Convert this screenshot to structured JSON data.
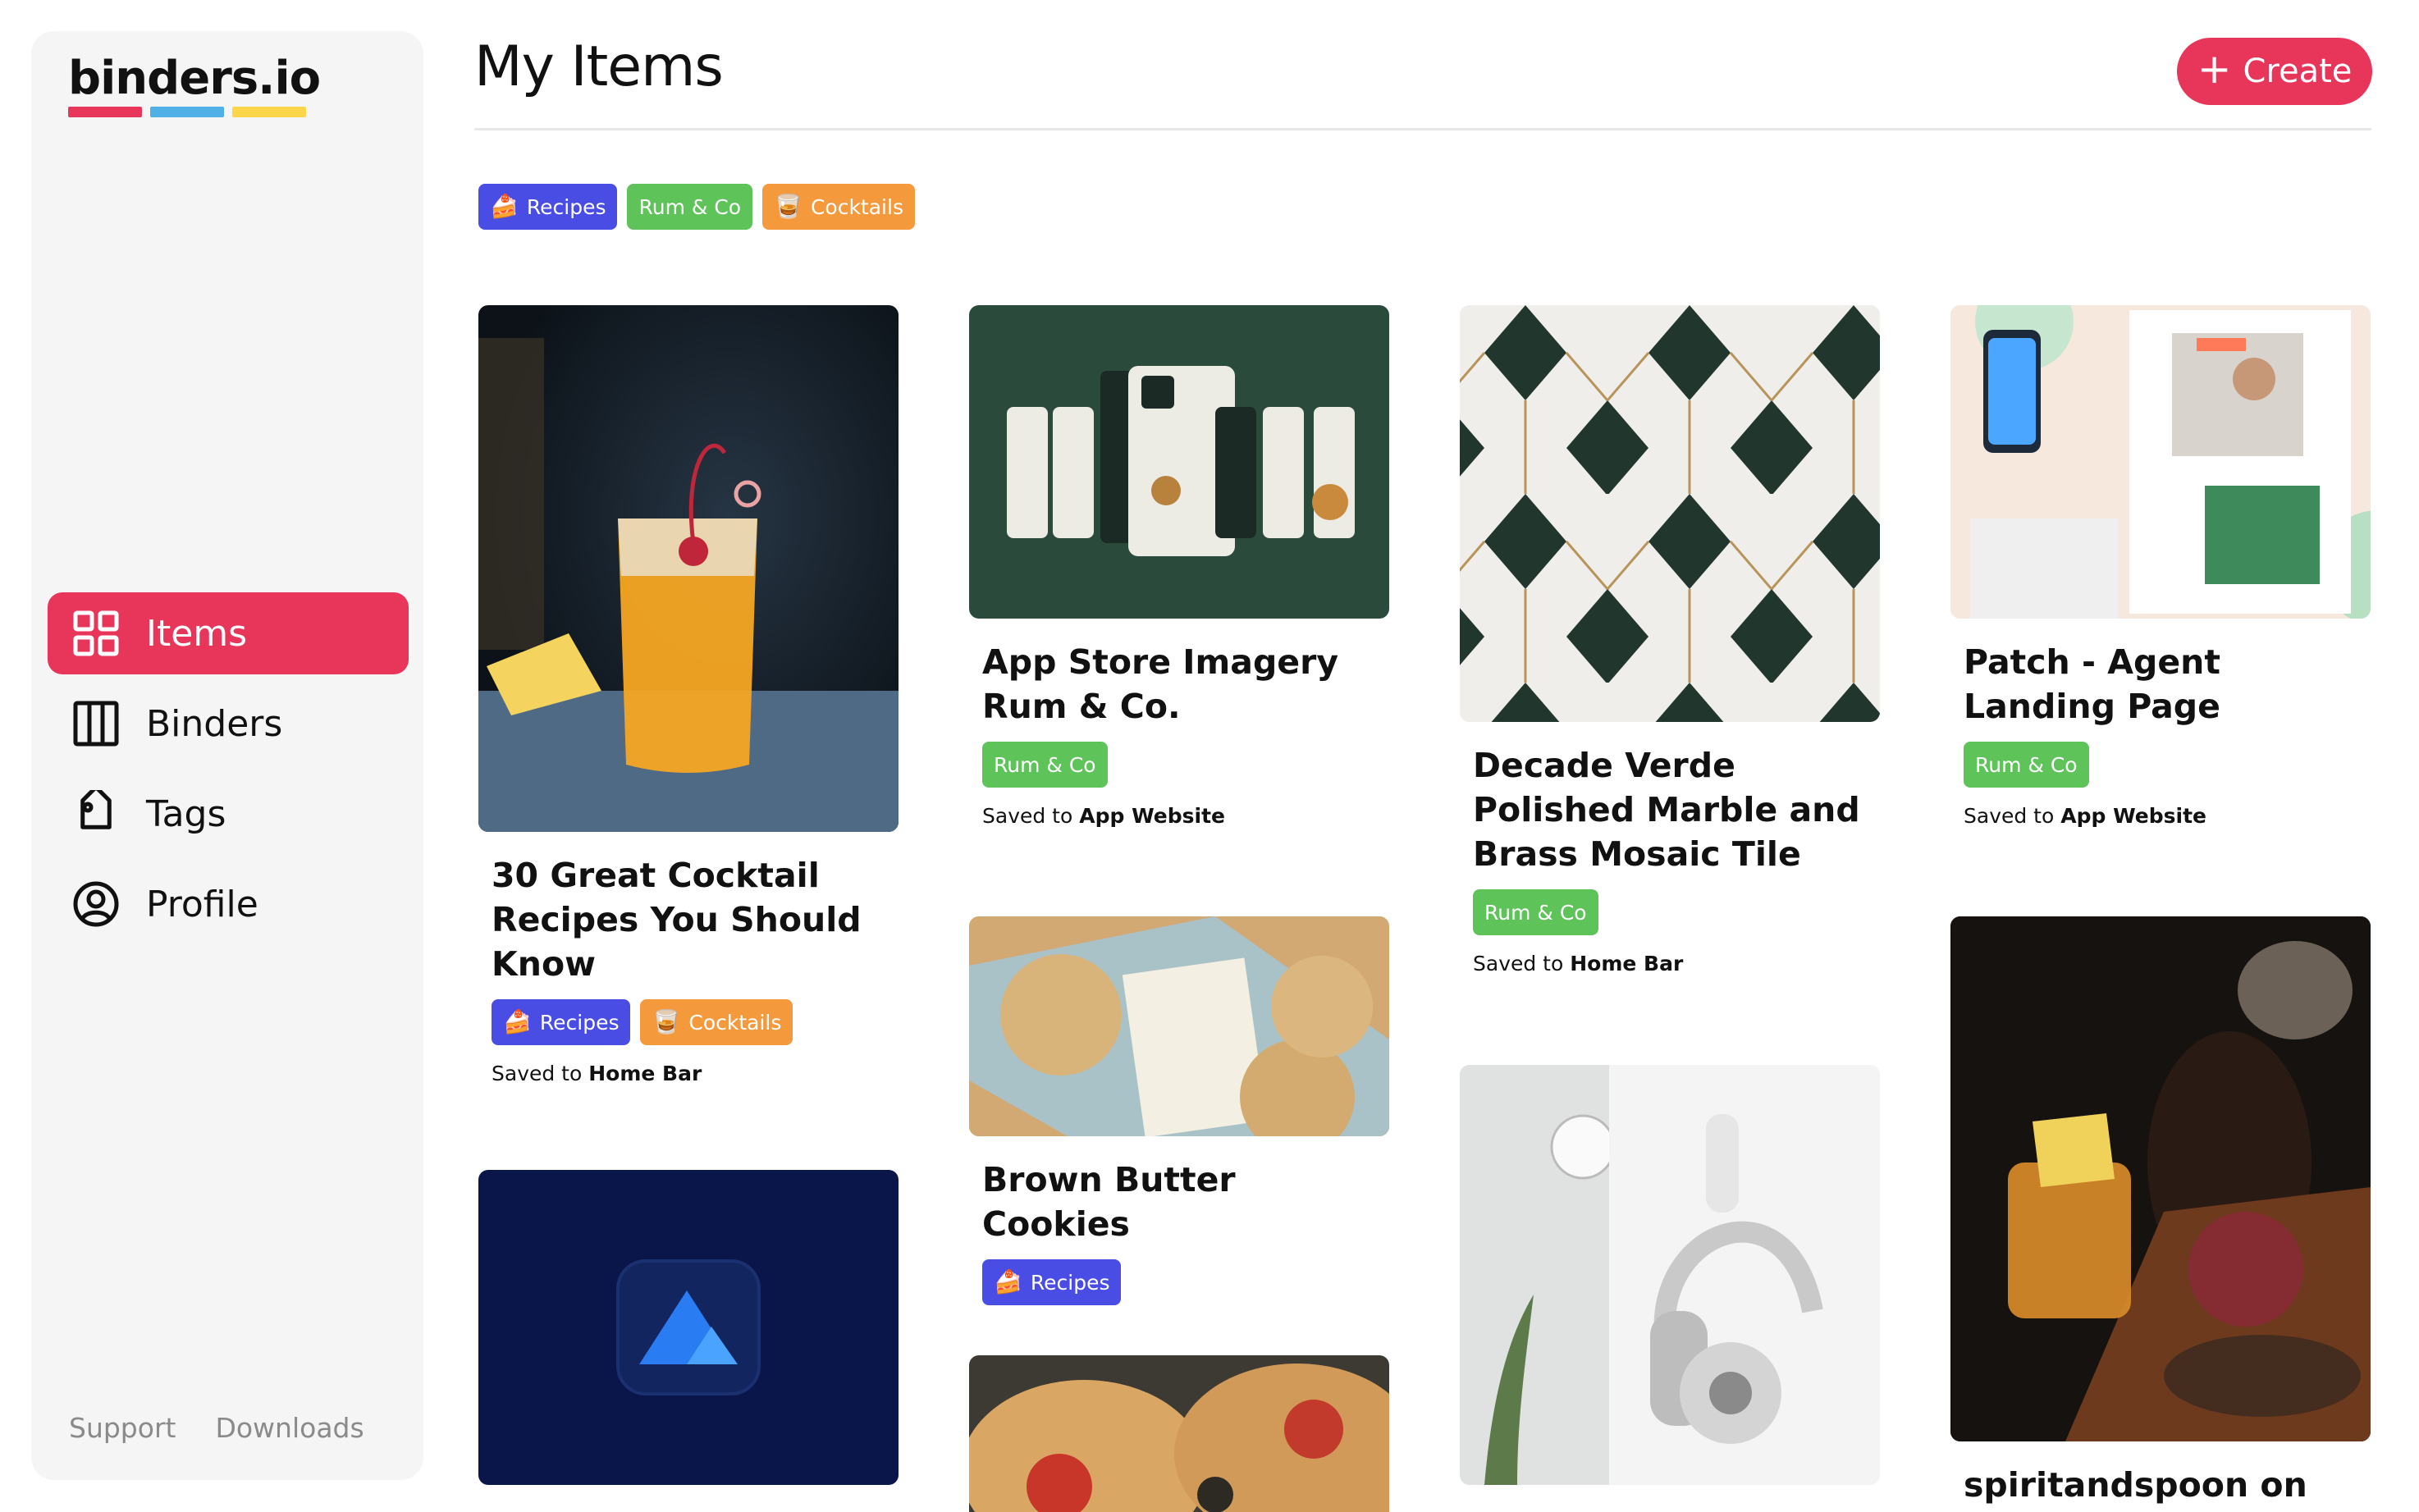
{
  "app": {
    "logo_text": "binders.io",
    "logo_colors": [
      "#e8365a",
      "#4fb0e6",
      "#fcd54b"
    ]
  },
  "sidebar": {
    "items": [
      {
        "label": "Items",
        "icon": "grid-icon",
        "active": true
      },
      {
        "label": "Binders",
        "icon": "columns-icon",
        "active": false
      },
      {
        "label": "Tags",
        "icon": "tag-icon",
        "active": false
      },
      {
        "label": "Profile",
        "icon": "user-circle-icon",
        "active": false
      }
    ],
    "footer": {
      "support": "Support",
      "downloads": "Downloads"
    }
  },
  "header": {
    "title": "My Items",
    "create_label": "Create"
  },
  "filters": [
    {
      "label": "Recipes",
      "color": "#4a4de3",
      "emoji": "🍰"
    },
    {
      "label": "Rum & Co",
      "color": "#5ec45a",
      "emoji": ""
    },
    {
      "label": "Cocktails",
      "color": "#f59a3c",
      "emoji": "🥃"
    }
  ],
  "tags": {
    "recipes": "Recipes",
    "rum": "Rum & Co",
    "cocktails": "Cocktails"
  },
  "saved_prefix": "Saved to",
  "cards": [
    {
      "title": "30 Great Cocktail Recipes You Should Know",
      "tags": [
        "Recipes",
        "Cocktails"
      ],
      "saved_to": "Home Bar"
    },
    {
      "title": "App Store Imagery Rum & Co.",
      "tags": [
        "Rum & Co"
      ],
      "saved_to": "App Website"
    },
    {
      "title": "Decade Verde Polished Marble and Brass Mosaic Tile",
      "tags": [
        "Rum & Co"
      ],
      "saved_to": "Home Bar"
    },
    {
      "title": "Patch - Agent Landing Page",
      "tags": [
        "Rum & Co"
      ],
      "saved_to": "App Website"
    },
    {
      "title": "Brown Butter Cookies",
      "tags": [
        "Recipes"
      ],
      "saved_to": ""
    },
    {
      "title": "spiritandspoon on",
      "tags": [],
      "saved_to": ""
    }
  ]
}
